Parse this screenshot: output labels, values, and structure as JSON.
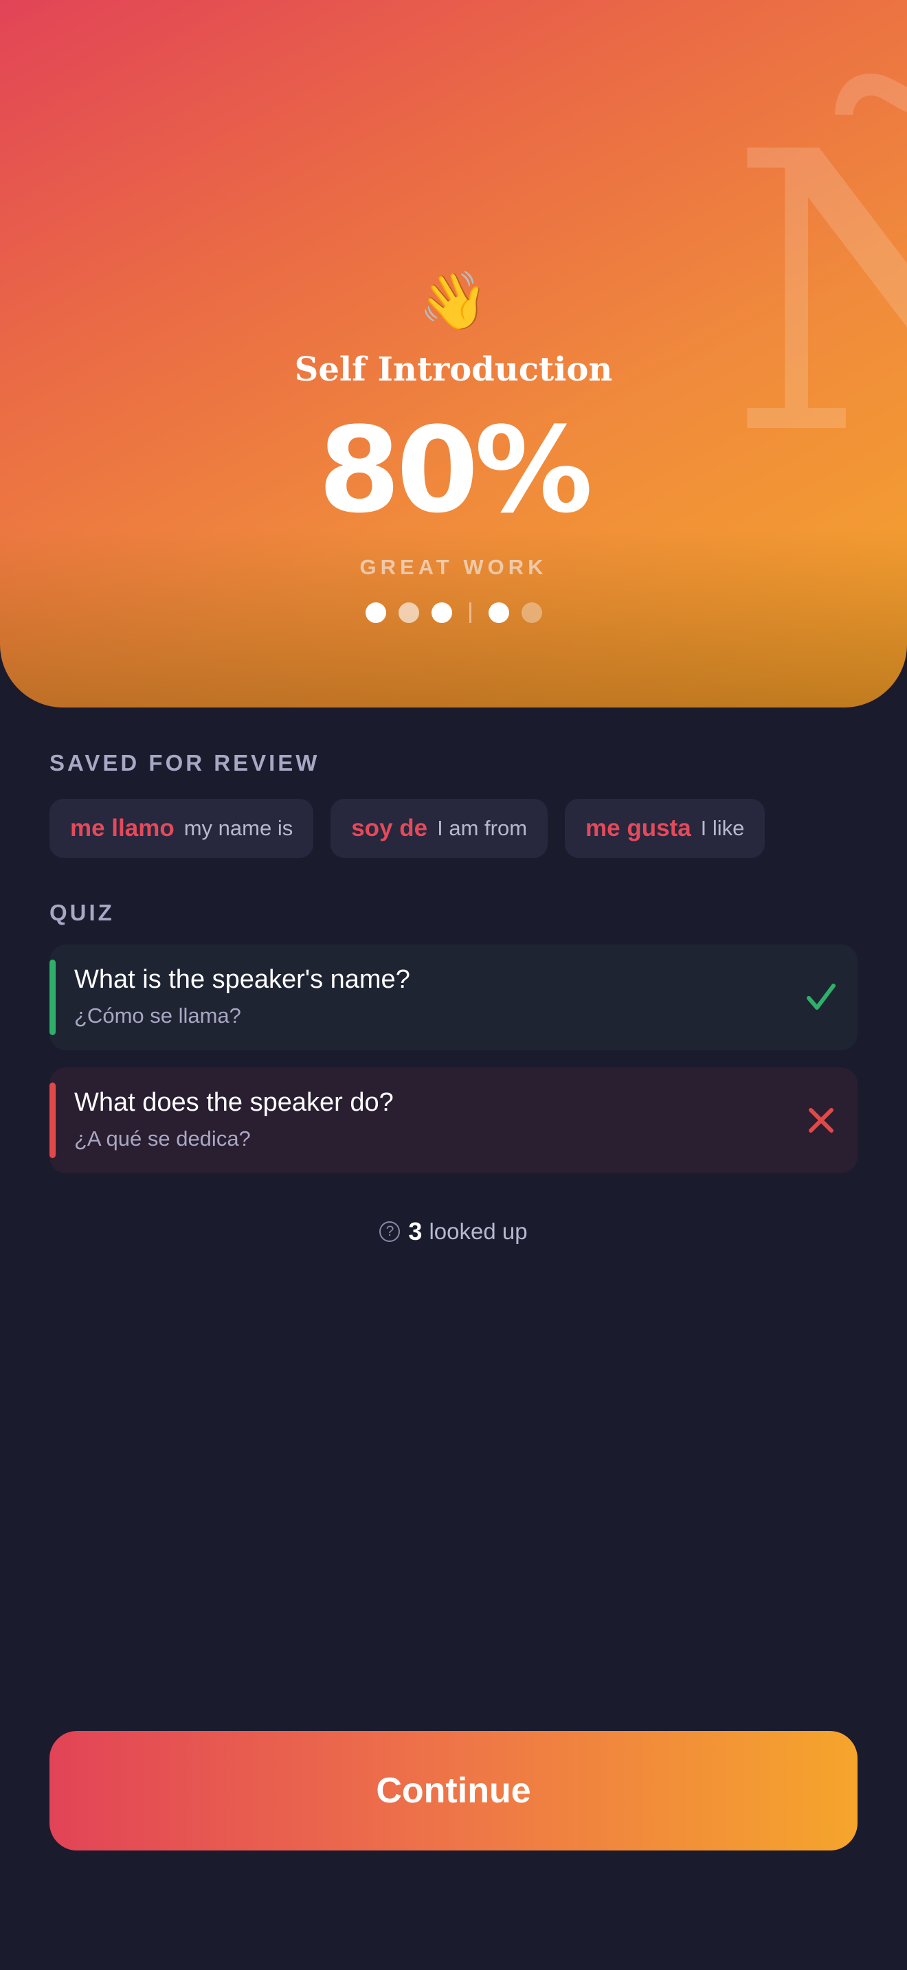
{
  "hero": {
    "background_letter": "Ñ",
    "emoji": "👋",
    "lesson_title": "Self Introduction",
    "score": "80%",
    "praise": "GREAT WORK",
    "progress_dots": [
      "full",
      "soft",
      "full",
      "separator",
      "full",
      "dim"
    ]
  },
  "saved": {
    "label": "SAVED FOR REVIEW",
    "chips": [
      {
        "spanish": "me llamo",
        "english": "my name is"
      },
      {
        "spanish": "soy de",
        "english": "I am from"
      },
      {
        "spanish": "me gusta",
        "english": "I like"
      }
    ]
  },
  "quiz": {
    "label": "QUIZ",
    "questions": [
      {
        "question": "What is the speaker's name?",
        "translation": "¿Cómo se llama?",
        "result": "correct"
      },
      {
        "question": "What does the speaker do?",
        "translation": "¿A qué se dedica?",
        "result": "incorrect"
      }
    ]
  },
  "lookups": {
    "icon": "?",
    "count": "3",
    "label": "looked up"
  },
  "continue_label": "Continue",
  "colors": {
    "accent_start": "#e24457",
    "accent_end": "#f5a52c",
    "correct": "#2fb06a",
    "incorrect": "#e24848"
  }
}
